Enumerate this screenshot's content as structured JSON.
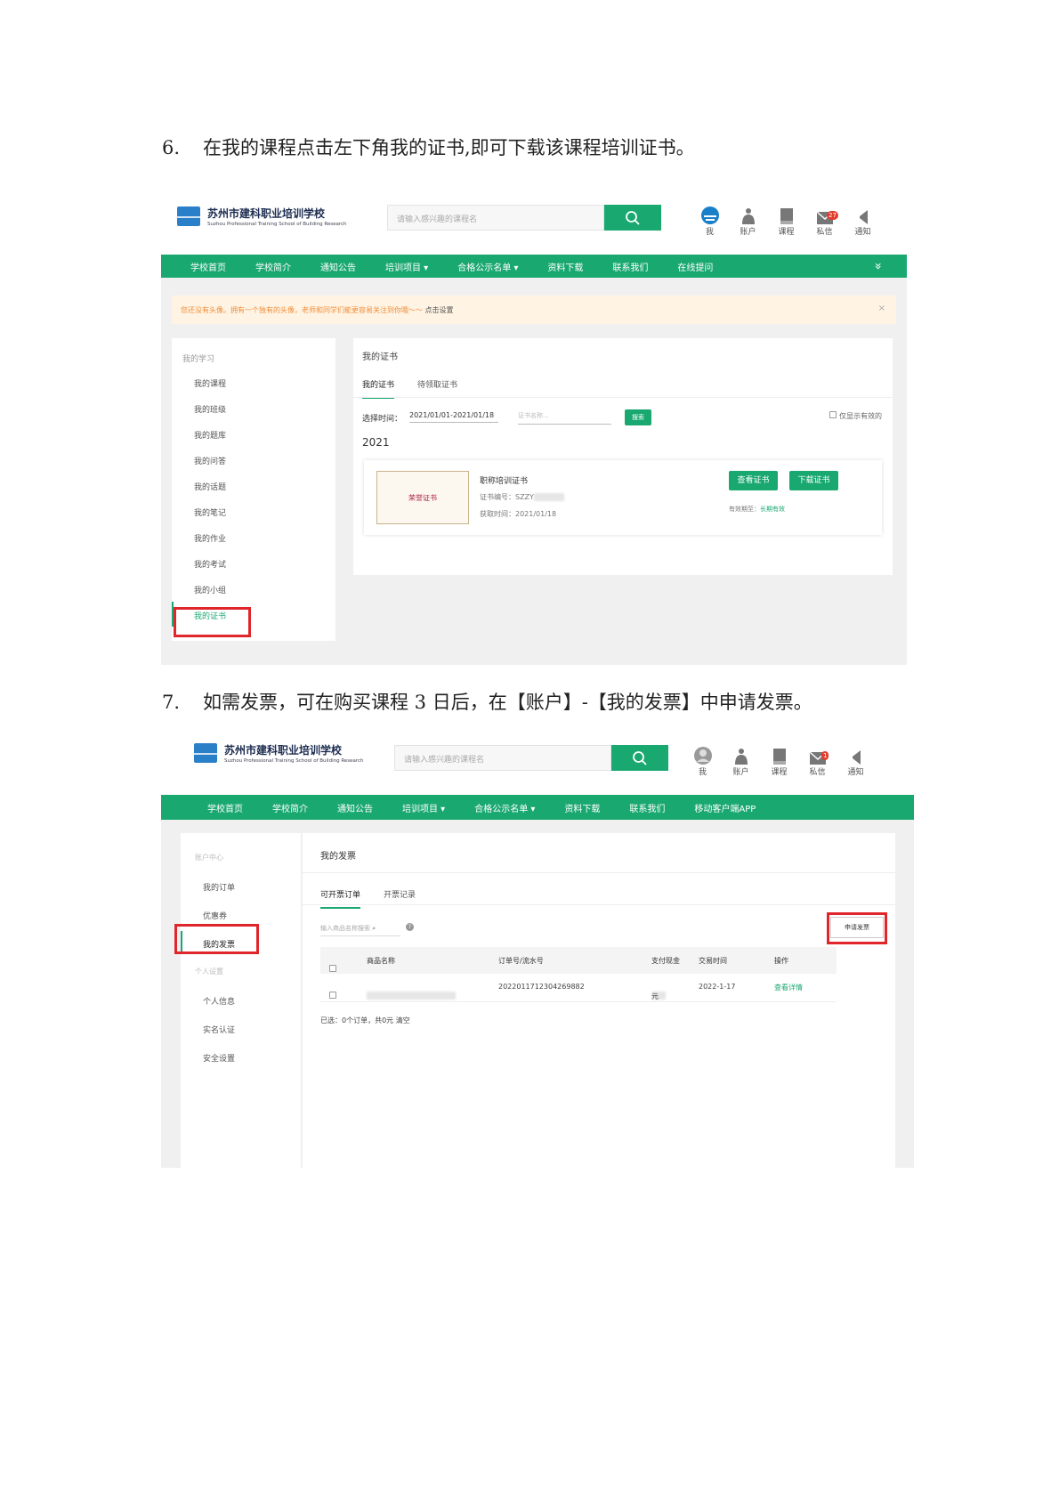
{
  "step6": {
    "num": "6.",
    "text": "在我的课程点击左下角我的证书,即可下载该课程培训证书。"
  },
  "step7": {
    "num": "7.",
    "text": "如需发票，可在购买课程 3 日后，在【账户】-【我的发票】中申请发票。"
  },
  "common": {
    "school_name": "苏州市建科职业培训学校",
    "school_name_en": "Suzhou Professional Training School of Building Research",
    "search_placeholder": "请输入感兴趣的课程名",
    "icons": [
      {
        "label": "我",
        "icon": "user-icon"
      },
      {
        "label": "账户",
        "icon": "account-icon"
      },
      {
        "label": "课程",
        "icon": "book-icon"
      },
      {
        "label": "私信",
        "icon": "mail-icon"
      },
      {
        "label": "通知",
        "icon": "speaker-icon"
      }
    ],
    "accent": "#1aa871",
    "highlight_box": "#e0262b"
  },
  "shot1": {
    "message_badge": "27",
    "nav": [
      "学校首页",
      "学校简介",
      "通知公告",
      "培训项目 ▾",
      "合格公示名单 ▾",
      "资料下载",
      "联系我们",
      "在线提问"
    ],
    "nav_more": "»",
    "alert": {
      "text": "您还没有头像。拥有一个独有的头像，老师和同学们能更容易关注到你哦～～",
      "link": "点击设置",
      "close": "×"
    },
    "sidebar": {
      "head": "我的学习",
      "items": [
        "我的课程",
        "我的班级",
        "我的题库",
        "我的问答",
        "我的话题",
        "我的笔记",
        "我的作业",
        "我的考试",
        "我的小组",
        "我的证书"
      ]
    },
    "main": {
      "title": "我的证书",
      "tabs": [
        "我的证书",
        "待领取证书"
      ],
      "filter_label": "选择时间：",
      "date_range": "2021/01/01-2021/01/18",
      "cert_name_placeholder": "证书名称...",
      "search_btn": "搜索",
      "only_valid": "仅显示有效的",
      "year": "2021",
      "cert": {
        "image_text": "荣誉证书",
        "name": "职称培训证书",
        "number_label": "证书编号：SZZY",
        "obtained": "获取时间：2021/01/18",
        "validity_label": "有效期至：",
        "validity_value": "长期有效",
        "view_btn": "查看证书",
        "download_btn": "下载证书"
      }
    }
  },
  "shot2": {
    "message_badge": "1",
    "nav": [
      "学校首页",
      "学校简介",
      "通知公告",
      "培训项目 ▾",
      "合格公示名单 ▾",
      "资料下载",
      "联系我们",
      "移动客户端APP"
    ],
    "sidebar": {
      "head1": "账户中心",
      "items1": [
        "我的订单",
        "优惠券",
        "我的发票"
      ],
      "head2": "个人设置",
      "items2": [
        "个人信息",
        "实名认证",
        "安全设置"
      ]
    },
    "main": {
      "title": "我的发票",
      "tabs": [
        "可开票订单",
        "开票记录"
      ],
      "search_placeholder": "输入商品名称搜索",
      "apply_btn": "申请发票",
      "columns": [
        "商品名称",
        "订单号/流水号",
        "支付现金",
        "交易时间",
        "操作"
      ],
      "row": {
        "order_no": "2022011712304269882",
        "amount": "元",
        "time": "2022-1-17",
        "action": "查看详情"
      },
      "summary": "已选：0个订单，共0元 清空"
    }
  }
}
